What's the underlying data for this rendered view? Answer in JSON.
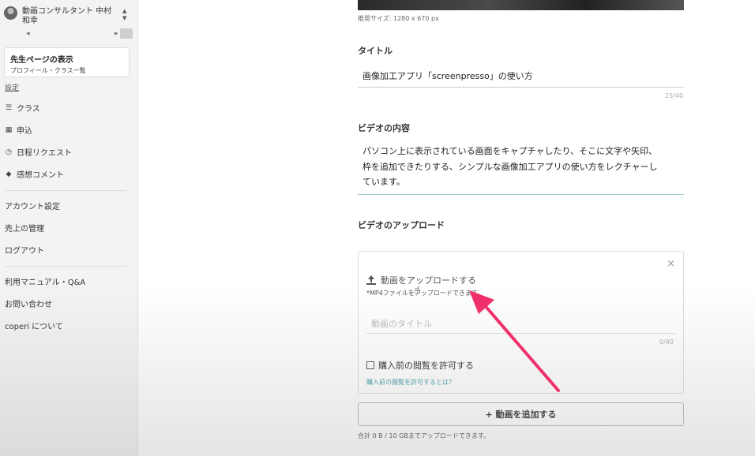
{
  "sidebar": {
    "profile_name": "動画コンサルタント 中村 和幸",
    "teacher_card": {
      "title": "先生ページの表示",
      "subtitle": "プロフィール・クラス一覧"
    },
    "settings_label": "設定",
    "nav": [
      {
        "label": "クラス",
        "icon": "list-icon"
      },
      {
        "label": "申込",
        "icon": "building-icon"
      },
      {
        "label": "日程リクエスト",
        "icon": "clock-icon"
      },
      {
        "label": "感想コメント",
        "icon": "comments-icon"
      }
    ],
    "account": [
      "アカウント設定",
      "売上の管理",
      "ログアウト"
    ],
    "help": [
      "利用マニュアル・Q&A",
      "お問い合わせ",
      "coperi について"
    ]
  },
  "main": {
    "recommended_size": "推奨サイズ: 1280 x 670 px",
    "title_label": "タイトル",
    "title_value": "画像加工アプリ「screenpresso」の使い方",
    "title_counter": "25/40",
    "desc_label": "ビデオの内容",
    "desc_line1": "パソコン上に表示されている画面をキャプチャしたり、そこに文字や矢印、",
    "desc_line2": "枠を追加できたりする、シンプルな画像加工アプリの使い方をレクチャーし",
    "desc_line3": "ています。",
    "upload_label": "ビデオのアップロード",
    "upload_panel": {
      "close": "×",
      "upload_button": "動画をアップロードする",
      "upload_note": "*MP4ファイルをアップロードできます。",
      "video_title_placeholder": "動画のタイトル",
      "video_title_counter": "0/40",
      "allow_preview_label": "購入前の閲覧を許可する",
      "allow_preview_help": "購入前の閲覧を許可するとは？"
    },
    "add_video_button": "+ 動画を追加する",
    "total_note": "合計 0 B / 10 GBまでアップロードできます。"
  },
  "colors": {
    "accent_link": "#4a9fb0",
    "annotation_arrow": "#f0306a"
  }
}
